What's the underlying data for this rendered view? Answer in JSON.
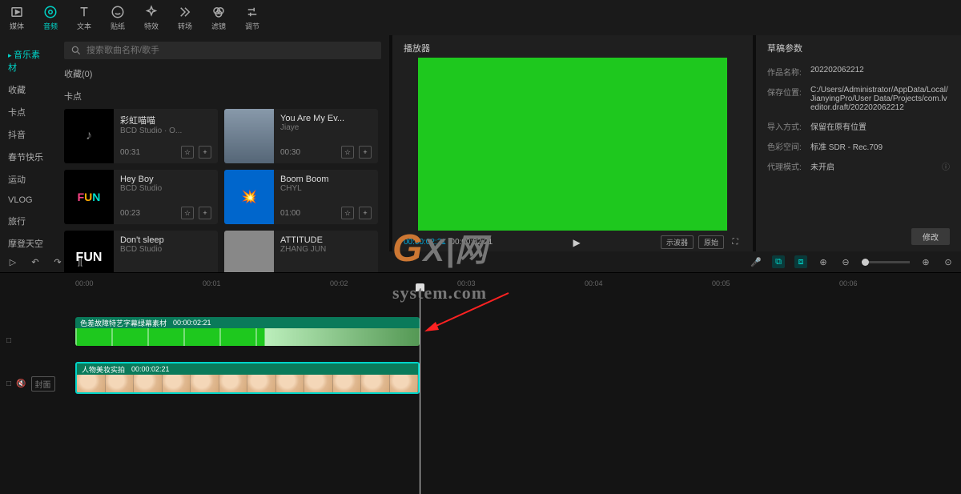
{
  "topTools": [
    {
      "name": "media",
      "label": "媒体",
      "active": false
    },
    {
      "name": "audio",
      "label": "音频",
      "active": true
    },
    {
      "name": "text",
      "label": "文本",
      "active": false
    },
    {
      "name": "sticker",
      "label": "贴纸",
      "active": false
    },
    {
      "name": "effect",
      "label": "特效",
      "active": false
    },
    {
      "name": "transition",
      "label": "转场",
      "active": false
    },
    {
      "name": "filter",
      "label": "滤镜",
      "active": false
    },
    {
      "name": "adjust",
      "label": "调节",
      "active": false
    }
  ],
  "sidebar": [
    {
      "label": "音乐素材",
      "active": true
    },
    {
      "label": "收藏"
    },
    {
      "label": "卡点"
    },
    {
      "label": "抖音"
    },
    {
      "label": "春节快乐"
    },
    {
      "label": "运动"
    },
    {
      "label": "VLOG"
    },
    {
      "label": "旅行"
    },
    {
      "label": "摩登天空"
    }
  ],
  "search": {
    "placeholder": "搜索歌曲名称/歌手"
  },
  "collect": {
    "label": "收藏(0)"
  },
  "section": {
    "title": "卡点"
  },
  "music": [
    {
      "title": "彩虹喵喵",
      "artist": "BCD Studio · O...",
      "dur": "00:31"
    },
    {
      "title": "You Are My Ev...",
      "artist": "Jiaye",
      "dur": "00:30"
    },
    {
      "title": "Hey Boy",
      "artist": "BCD Studio",
      "dur": "00:23"
    },
    {
      "title": "Boom Boom",
      "artist": "CHYL",
      "dur": "01:00"
    },
    {
      "title": "Don't sleep",
      "artist": "BCD Studio",
      "dur": ""
    },
    {
      "title": "ATTITUDE",
      "artist": "ZHANG JUN",
      "dur": ""
    }
  ],
  "player": {
    "title": "播放器",
    "cur": "00:00:02:21",
    "total": "00:00:02:21",
    "btn1": "示波器",
    "btn2": "原始"
  },
  "draft": {
    "title": "草稿参数",
    "rows": [
      {
        "k": "作品名称:",
        "v": "202202062212"
      },
      {
        "k": "保存位置:",
        "v": "C:/Users/Administrator/AppData/Local/JianyingPro/User Data/Projects/com.lveditor.draft/202202062212"
      },
      {
        "k": "导入方式:",
        "v": "保留在原有位置"
      },
      {
        "k": "色彩空间:",
        "v": "标准 SDR - Rec.709"
      },
      {
        "k": "代理模式:",
        "v": "未开启"
      }
    ],
    "modify": "修改"
  },
  "watermark": {
    "g": "G",
    "rest": "X|网",
    "sys": "system.com"
  },
  "ruler": [
    "00:00",
    "00:01",
    "00:02",
    "00:03",
    "00:04",
    "00:05",
    "00:06"
  ],
  "clips": [
    {
      "name": "色差故障特艺字幕绿幕素材",
      "dur": "00:00:02:21"
    },
    {
      "name": "人物美妆实拍",
      "dur": "00:00:02:21"
    }
  ],
  "coverLabel": "封面"
}
